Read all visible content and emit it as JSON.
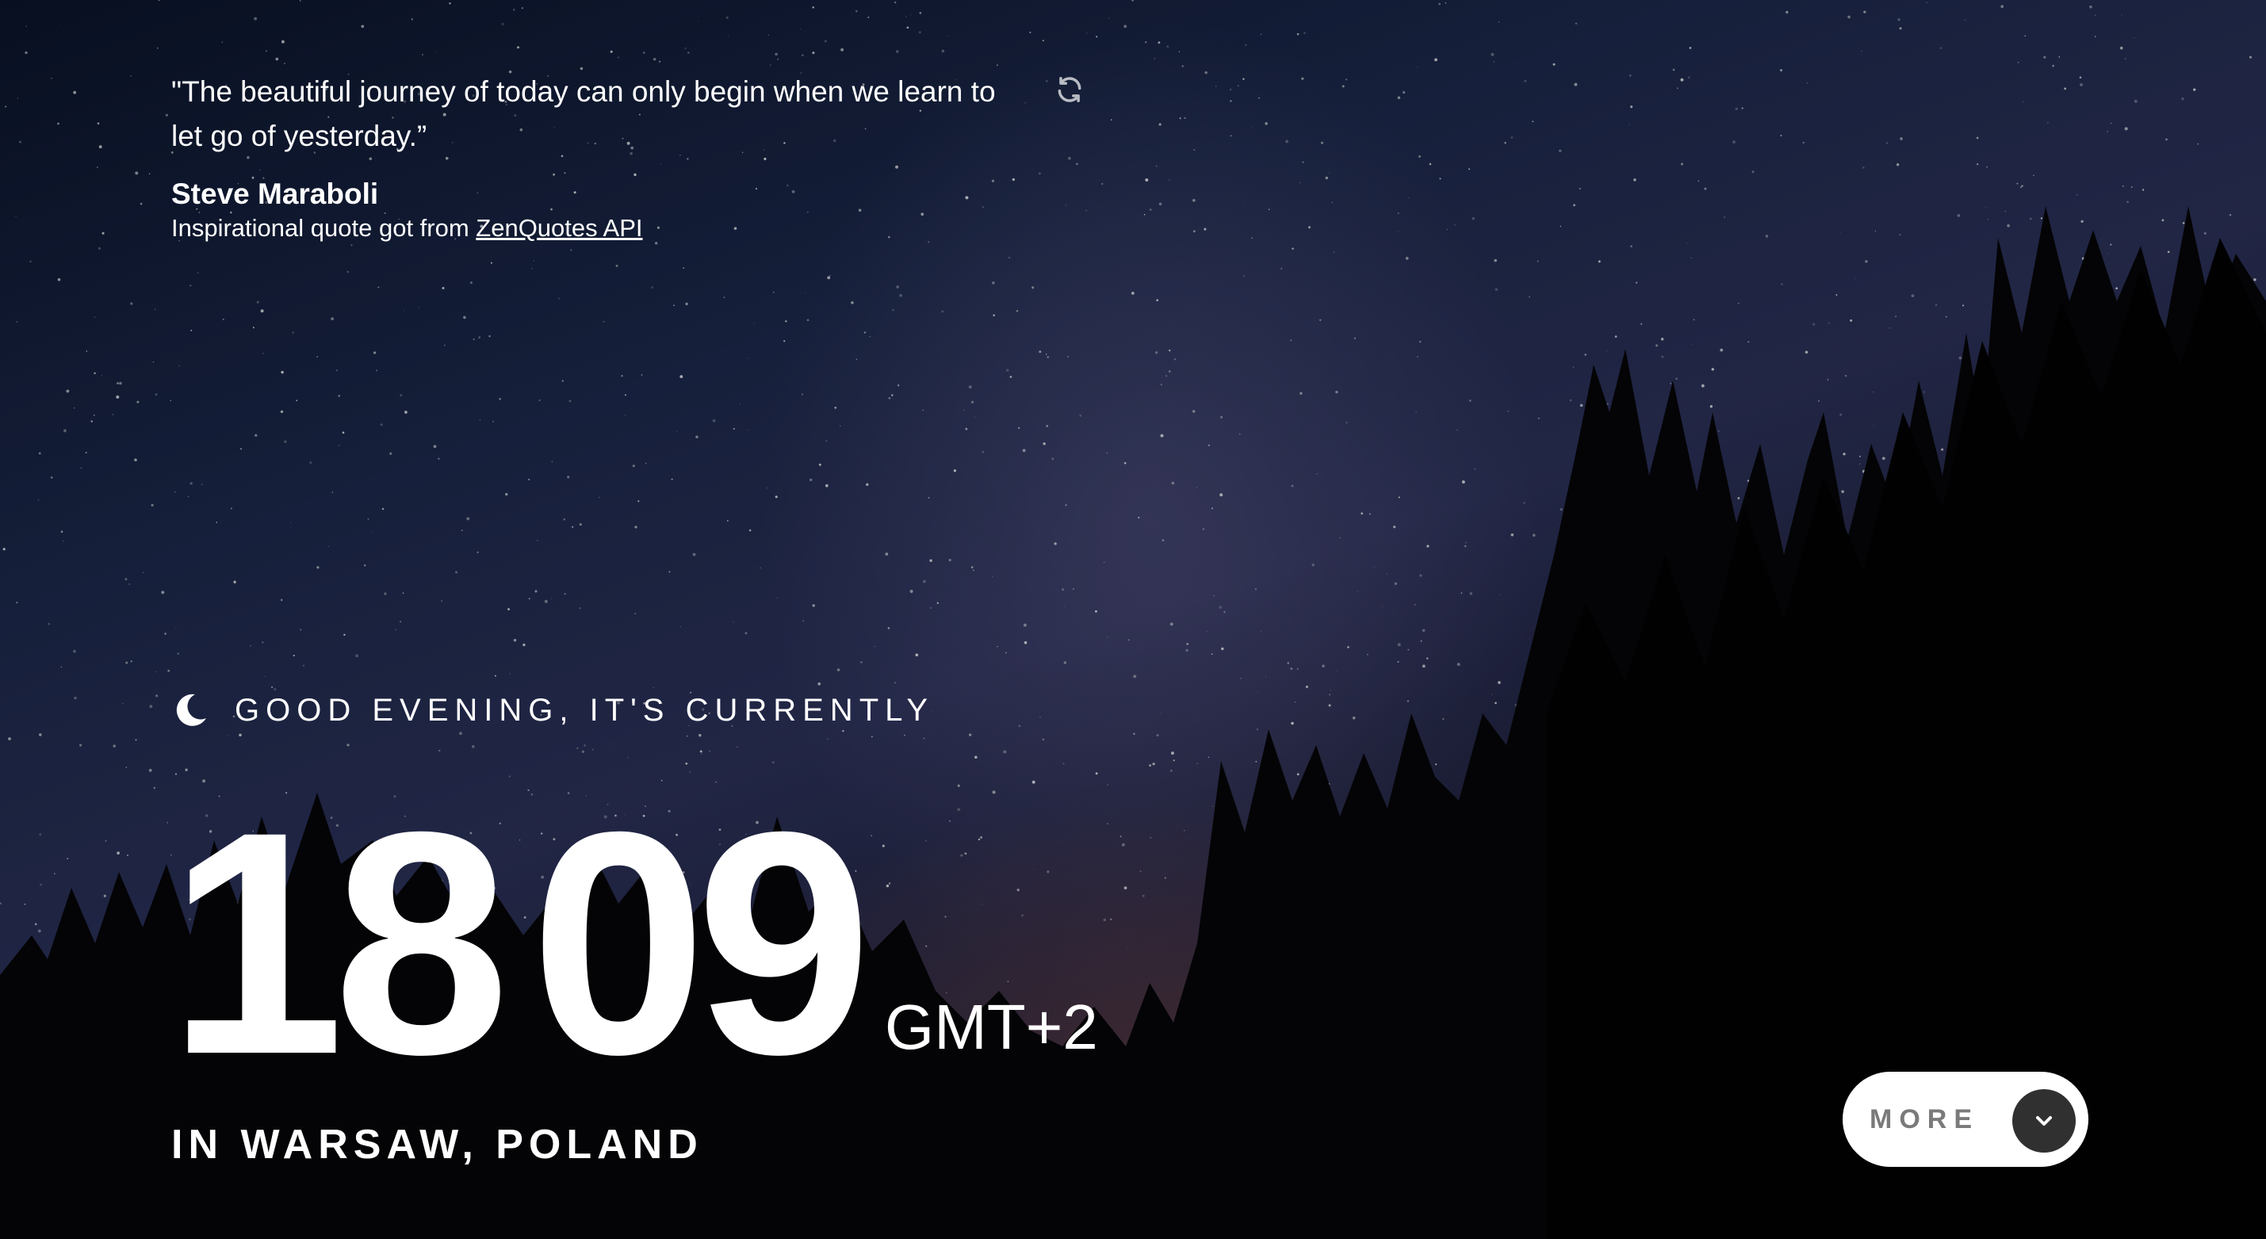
{
  "quote": {
    "text": "\"The beautiful journey of today can only begin when we learn to let go of yesterday.”",
    "author": "Steve Maraboli",
    "source_prefix": "Inspirational quote got from ",
    "source_link": "ZenQuotes API"
  },
  "greeting": {
    "text": "GOOD EVENING, IT'S CURRENTLY",
    "icon": "moon-icon"
  },
  "time": {
    "hours": "18",
    "minutes": "09",
    "timezone": "GMT+2"
  },
  "location": {
    "text": "IN WARSAW, POLAND"
  },
  "more_button": {
    "label": "MORE",
    "icon": "chevron-down-icon"
  },
  "icons": {
    "refresh": "refresh-icon"
  },
  "colors": {
    "text": "#ffffff",
    "button_bg": "#ffffff",
    "button_label": "#7a7a7a",
    "button_circle": "#303030"
  }
}
